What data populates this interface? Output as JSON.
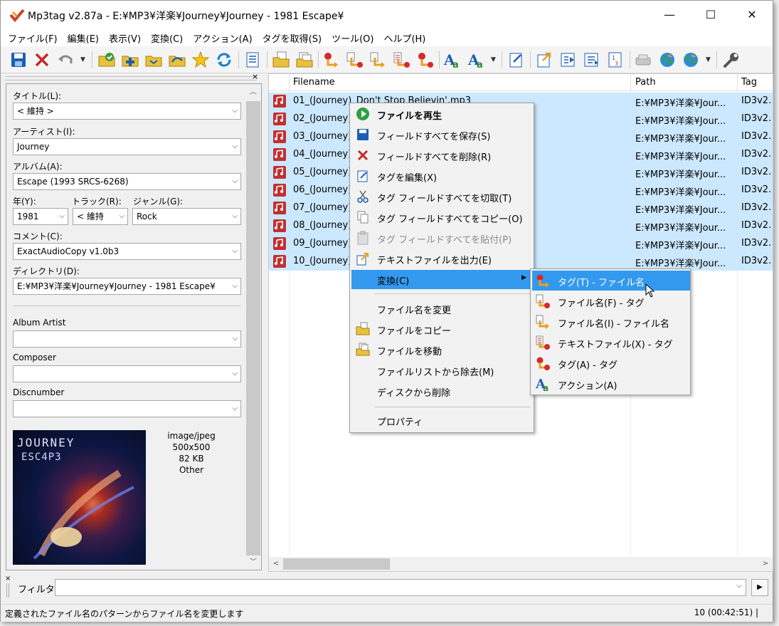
{
  "window": {
    "title": "Mp3tag v2.87a  -  E:¥MP3¥洋楽¥Journey¥Journey - 1981 Escape¥",
    "min": "—",
    "max": "☐",
    "close": "✕"
  },
  "menu": [
    "ファイル(F)",
    "編集(E)",
    "表示(V)",
    "変換(C)",
    "アクション(A)",
    "タグを取得(S)",
    "ツール(O)",
    "ヘルプ(H)"
  ],
  "tag_panel": {
    "title_label": "タイトル(L):",
    "title_value": "< 維持 >",
    "artist_label": "アーティスト(I):",
    "artist_value": "Journey",
    "album_label": "アルバム(A):",
    "album_value": "Escape (1993 SRCS-6268)",
    "year_label": "年(Y):",
    "year_value": "1981",
    "track_label": "トラック(R):",
    "track_value": "< 維持",
    "genre_label": "ジャンル(G):",
    "genre_value": "Rock",
    "comment_label": "コメント(C):",
    "comment_value": "ExactAudioCopy v1.0b3",
    "directory_label": "ディレクトリ(D):",
    "directory_value": "E:¥MP3¥洋楽¥Journey¥Journey - 1981 Escape¥",
    "album_artist_label": "Album Artist",
    "composer_label": "Composer",
    "discnumber_label": "Discnumber",
    "cover": {
      "art_title": "JOURNEY",
      "art_subtitle": "ESC4P3",
      "mime": "image/jpeg",
      "dimensions": "500x500",
      "size": "82 KB",
      "type": "Other"
    }
  },
  "file_list": {
    "columns": [
      "Filename",
      "Path",
      "Tag"
    ],
    "rows": [
      {
        "filename": "01_(Journey)_Don't Stop Believin'.mp3",
        "path": "E:¥MP3¥洋楽¥Jour...",
        "tag": "ID3v2."
      },
      {
        "filename": "02_(Journey)",
        "path": "E:¥MP3¥洋楽¥Jour...",
        "tag": "ID3v2."
      },
      {
        "filename": "03_(Journey)",
        "path": "E:¥MP3¥洋楽¥Jour...",
        "tag": "ID3v2."
      },
      {
        "filename": "04_(Journey)",
        "path": "E:¥MP3¥洋楽¥Jour...",
        "tag": "ID3v2."
      },
      {
        "filename": "05_(Journey)",
        "path": "E:¥MP3¥洋楽¥Jour...",
        "tag": "ID3v2."
      },
      {
        "filename": "06_(Journey)",
        "path": "E:¥MP3¥洋楽¥Jour...",
        "tag": "ID3v2."
      },
      {
        "filename": "07_(Journey)",
        "path": "E:¥MP3¥洋楽¥Jour...",
        "tag": "ID3v2."
      },
      {
        "filename": "08_(Journey)",
        "path": "E:¥MP3¥洋楽¥Jour...",
        "tag": "ID3v2."
      },
      {
        "filename": "09_(Journey)",
        "path": "E:¥MP3¥洋楽¥Jour...",
        "tag": "ID3v2."
      },
      {
        "filename": "10_(Journey)",
        "path": "E:¥MP3¥洋楽¥Jour...",
        "tag": "ID3v2."
      }
    ]
  },
  "context_menu": {
    "play": "ファイルを再生",
    "save": "フィールドすべてを保存(S)",
    "remove": "フィールドすべてを削除(R)",
    "edit_tag": "タグを編集(X)",
    "cut": "タグ フィールドすべてを切取(T)",
    "copy": "タグ フィールドすべてをコピー(O)",
    "paste": "タグ フィールドすべてを貼付(P)",
    "export": "テキストファイルを出力(E)",
    "convert": "変換(C)",
    "rename": "ファイル名を変更",
    "copy_file": "ファイルをコピー",
    "move_file": "ファイルを移動",
    "remove_from_list": "ファイルリストから除去(M)",
    "delete_from_disk": "ディスクから削除",
    "properties": "プロパティ"
  },
  "convert_submenu": {
    "tag_to_filename": "タグ(T) - ファイル名",
    "filename_to_tag": "ファイル名(F) - タグ",
    "filename_to_filename": "ファイル名(I) - ファイル名",
    "textfile_to_tag": "テキストファイル(X) - タグ",
    "tag_to_tag": "タグ(A) - タグ",
    "action": "アクション(A)"
  },
  "filter": {
    "label": "フィルタ:",
    "value": ""
  },
  "status": {
    "message": "定義されたファイル名のパターンからファイル名を変更します",
    "summary": "10 (00:42:51) |"
  }
}
